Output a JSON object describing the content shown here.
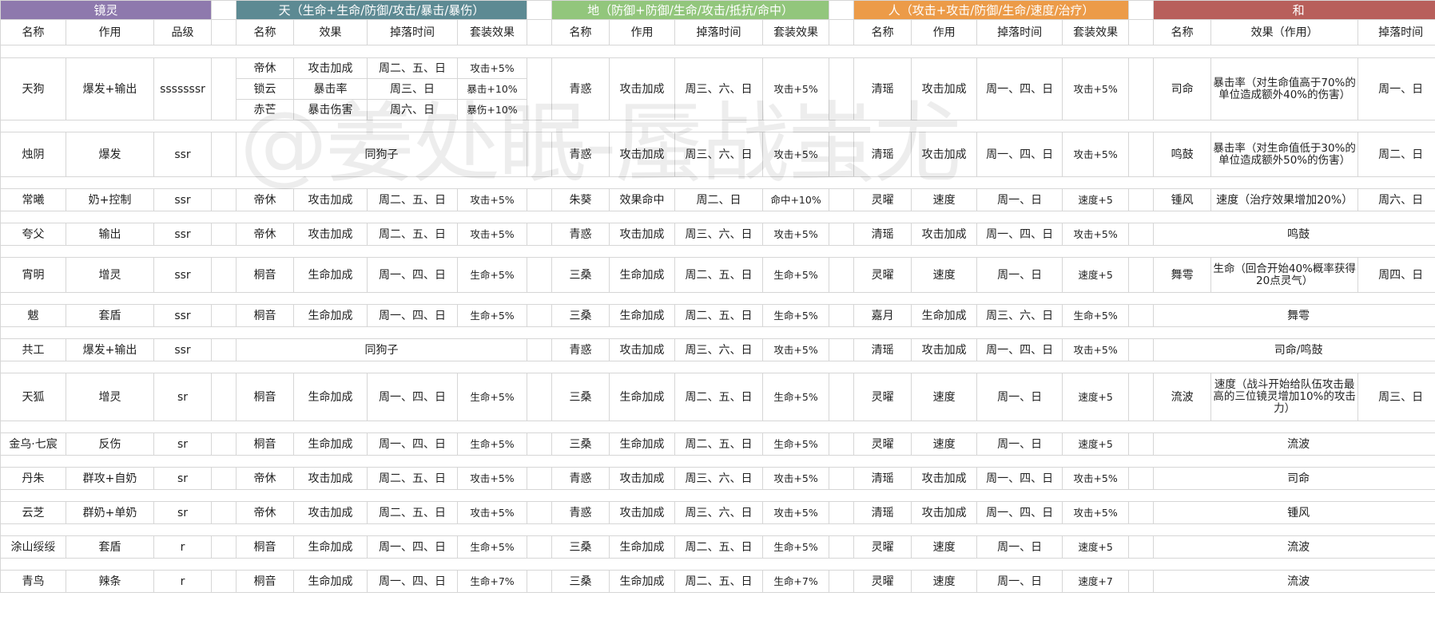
{
  "watermark": "@姜处眠-蜃战蚩尤",
  "groups": {
    "jingling": "镜灵",
    "tian": "天（生命+生命/防御/攻击/暴击/暴伤）",
    "di": "地（防御+防御/生命/攻击/抵抗/命中）",
    "ren": "人（攻击+攻击/防御/生命/速度/治疗）",
    "he": "和"
  },
  "col_headers": {
    "jl": [
      "名称",
      "作用",
      "品级"
    ],
    "tian": [
      "名称",
      "效果",
      "掉落时间",
      "套装效果"
    ],
    "di": [
      "名称",
      "作用",
      "掉落时间",
      "套装效果"
    ],
    "ren": [
      "名称",
      "作用",
      "掉落时间",
      "套装效果"
    ],
    "he": [
      "名称",
      "效果（作用）",
      "掉落时间"
    ]
  },
  "rows": {
    "tiangou": {
      "name": "天狗",
      "role": "爆发+输出",
      "grade": "sssssssr",
      "tian": [
        [
          "帝休",
          "攻击加成",
          "周二、五、日",
          "攻击+5%"
        ],
        [
          "锁云",
          "暴击率",
          "周三、日",
          "暴击+10%"
        ],
        [
          "赤芒",
          "暴击伤害",
          "周六、日",
          "暴伤+10%"
        ]
      ],
      "di": [
        "青惑",
        "攻击加成",
        "周三、六、日",
        "攻击+5%"
      ],
      "ren": [
        "清瑶",
        "攻击加成",
        "周一、四、日",
        "攻击+5%"
      ],
      "he": [
        "司命",
        "暴击率（对生命值高于70%的单位造成额外40%的伤害）",
        "周一、日"
      ]
    },
    "zhuyin": {
      "name": "烛阴",
      "role": "爆发",
      "grade": "ssr",
      "tian_note": "同狗子",
      "di": [
        "青惑",
        "攻击加成",
        "周三、六、日",
        "攻击+5%"
      ],
      "ren": [
        "清瑶",
        "攻击加成",
        "周一、四、日",
        "攻击+5%"
      ],
      "he": [
        "鸣鼓",
        "暴击率（对生命值低于30%的单位造成额外50%的伤害）",
        "周二、日"
      ]
    },
    "changxi": {
      "name": "常曦",
      "role": "奶+控制",
      "grade": "ssr",
      "tian": [
        "帝休",
        "攻击加成",
        "周二、五、日",
        "攻击+5%"
      ],
      "di": [
        "朱葵",
        "效果命中",
        "周二、日",
        "命中+10%"
      ],
      "ren": [
        "灵曜",
        "速度",
        "周一、日",
        "速度+5"
      ],
      "he": [
        "锺风",
        "速度（治疗效果增加20%）",
        "周六、日"
      ]
    },
    "kuafu": {
      "name": "夸父",
      "role": "输出",
      "grade": "ssr",
      "tian": [
        "帝休",
        "攻击加成",
        "周二、五、日",
        "攻击+5%"
      ],
      "di": [
        "青惑",
        "攻击加成",
        "周三、六、日",
        "攻击+5%"
      ],
      "ren": [
        "清瑶",
        "攻击加成",
        "周一、四、日",
        "攻击+5%"
      ],
      "he_note": "鸣鼓"
    },
    "xiaoming": {
      "name": "宵明",
      "role": "增灵",
      "grade": "ssr",
      "tian": [
        "桐音",
        "生命加成",
        "周一、四、日",
        "生命+5%"
      ],
      "di": [
        "三桑",
        "生命加成",
        "周二、五、日",
        "生命+5%"
      ],
      "ren": [
        "灵曜",
        "速度",
        "周一、日",
        "速度+5"
      ],
      "he": [
        "舞雩",
        "生命（回合开始40%概率获得20点灵气）",
        "周四、日"
      ]
    },
    "ba": {
      "name": "魃",
      "role": "套盾",
      "grade": "ssr",
      "tian": [
        "桐音",
        "生命加成",
        "周一、四、日",
        "生命+5%"
      ],
      "di": [
        "三桑",
        "生命加成",
        "周二、五、日",
        "生命+5%"
      ],
      "ren": [
        "嘉月",
        "生命加成",
        "周三、六、日",
        "生命+5%"
      ],
      "he_note": "舞雩"
    },
    "gonggong": {
      "name": "共工",
      "role": "爆发+输出",
      "grade": "ssr",
      "tian_note": "同狗子",
      "di": [
        "青惑",
        "攻击加成",
        "周三、六、日",
        "攻击+5%"
      ],
      "ren": [
        "清瑶",
        "攻击加成",
        "周一、四、日",
        "攻击+5%"
      ],
      "he_note": "司命/鸣鼓"
    },
    "tianhu": {
      "name": "天狐",
      "role": "增灵",
      "grade": "sr",
      "tian": [
        "桐音",
        "生命加成",
        "周一、四、日",
        "生命+5%"
      ],
      "di": [
        "三桑",
        "生命加成",
        "周二、五、日",
        "生命+5%"
      ],
      "ren": [
        "灵曜",
        "速度",
        "周一、日",
        "速度+5"
      ],
      "he": [
        "流波",
        "速度（战斗开始给队伍攻击最高的三位镜灵增加10%的攻击力）",
        "周三、日"
      ]
    },
    "jinwu": {
      "name": "金乌·七宸",
      "role": "反伤",
      "grade": "sr",
      "tian": [
        "桐音",
        "生命加成",
        "周一、四、日",
        "生命+5%"
      ],
      "di": [
        "三桑",
        "生命加成",
        "周二、五、日",
        "生命+5%"
      ],
      "ren": [
        "灵曜",
        "速度",
        "周一、日",
        "速度+5"
      ],
      "he_note": "流波"
    },
    "danzhu": {
      "name": "丹朱",
      "role": "群攻+自奶",
      "grade": "sr",
      "tian": [
        "帝休",
        "攻击加成",
        "周二、五、日",
        "攻击+5%"
      ],
      "di": [
        "青惑",
        "攻击加成",
        "周三、六、日",
        "攻击+5%"
      ],
      "ren": [
        "清瑶",
        "攻击加成",
        "周一、四、日",
        "攻击+5%"
      ],
      "he_note": "司命"
    },
    "yunzhi": {
      "name": "云芝",
      "role": "群奶+单奶",
      "grade": "sr",
      "tian": [
        "帝休",
        "攻击加成",
        "周二、五、日",
        "攻击+5%"
      ],
      "di": [
        "青惑",
        "攻击加成",
        "周三、六、日",
        "攻击+5%"
      ],
      "ren": [
        "清瑶",
        "攻击加成",
        "周一、四、日",
        "攻击+5%"
      ],
      "he_note": "锺风"
    },
    "tushan": {
      "name": "涂山绥绥",
      "role": "套盾",
      "grade": "r",
      "tian": [
        "桐音",
        "生命加成",
        "周一、四、日",
        "生命+5%"
      ],
      "di": [
        "三桑",
        "生命加成",
        "周二、五、日",
        "生命+5%"
      ],
      "ren": [
        "灵曜",
        "速度",
        "周一、日",
        "速度+5"
      ],
      "he_note": "流波"
    },
    "qingniao": {
      "name": "青鸟",
      "role": "辣条",
      "grade": "r",
      "tian": [
        "桐音",
        "生命加成",
        "周一、四、日",
        "生命+7%"
      ],
      "di": [
        "三桑",
        "生命加成",
        "周二、五、日",
        "生命+7%"
      ],
      "ren": [
        "灵曜",
        "速度",
        "周一、日",
        "速度+7"
      ],
      "he_note": "流波"
    }
  }
}
